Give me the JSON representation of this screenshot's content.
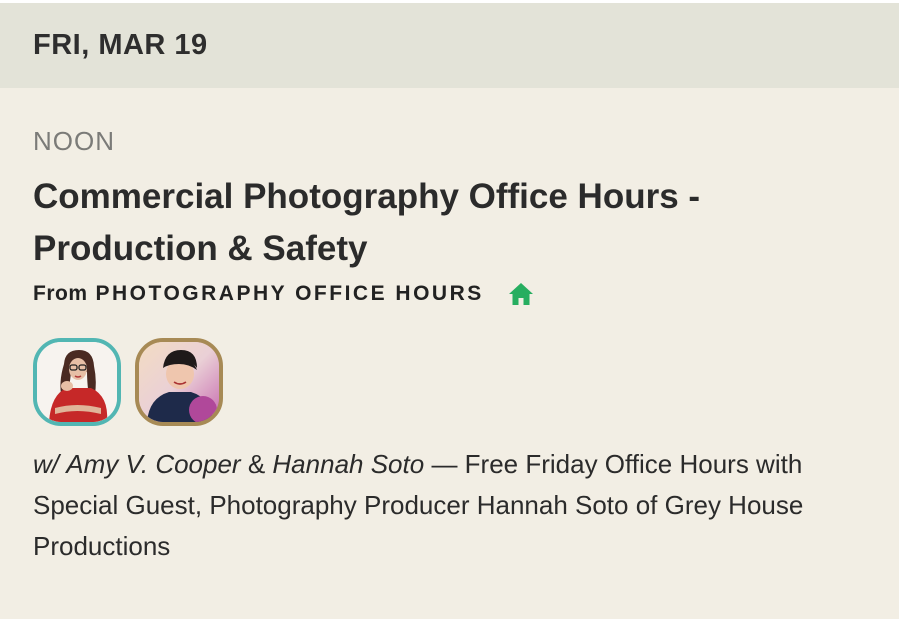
{
  "date_header": {
    "label": "FRI, MAR 19"
  },
  "event": {
    "time": "NOON",
    "title": "Commercial Photography Office Hours - Production & Safety",
    "club": {
      "prefix": "From",
      "name": "PHOTOGRAPHY OFFICE HOURS",
      "icon": "house-icon",
      "icon_color": "#27ae60"
    },
    "hosts": [
      {
        "name": "Amy V. Cooper",
        "ring_color": "#52b6b3"
      },
      {
        "name": "Hannah Soto",
        "ring_color": "#a78a55"
      }
    ],
    "description": {
      "prefix": "w/",
      "host_1": "Amy V. Cooper",
      "joiner": "&",
      "host_2": "Hannah Soto",
      "text": "— Free Friday Office Hours with Special Guest, Photography Producer Hannah Soto of Grey House Productions"
    }
  },
  "colors": {
    "background": "#f2eee4",
    "header_background": "#e3e3d8",
    "text": "#2b2b2b",
    "muted_text": "#7b7b78"
  }
}
